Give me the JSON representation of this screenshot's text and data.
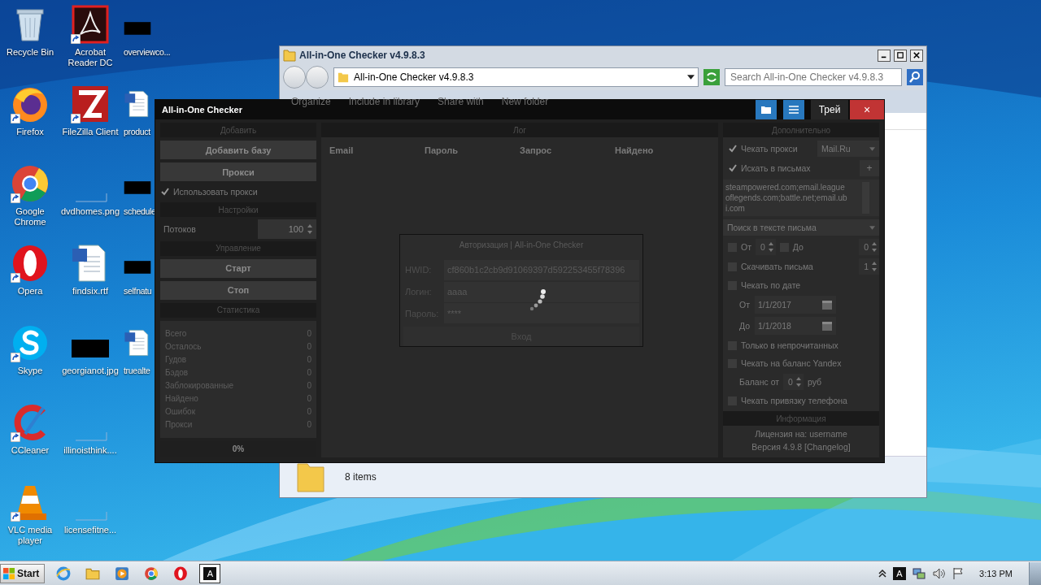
{
  "desktop": {
    "columns": [
      [
        {
          "label": "Recycle Bin",
          "kind": "recycle",
          "shortcut": false
        },
        {
          "label": "Firefox",
          "kind": "firefox",
          "shortcut": true
        },
        {
          "label": "Google Chrome",
          "kind": "chrome",
          "shortcut": true
        },
        {
          "label": "Opera",
          "kind": "opera",
          "shortcut": true
        },
        {
          "label": "Skype",
          "kind": "skype",
          "shortcut": true
        },
        {
          "label": "CCleaner",
          "kind": "ccleaner",
          "shortcut": true
        },
        {
          "label": "VLC media player",
          "kind": "vlc",
          "shortcut": true
        }
      ],
      [
        {
          "label": "Acrobat Reader DC",
          "kind": "acrobat",
          "shortcut": true
        },
        {
          "label": "FileZilla Client",
          "kind": "filezilla",
          "shortcut": true
        },
        {
          "label": "dvdhomes.png",
          "kind": "blank",
          "shortcut": false
        },
        {
          "label": "findsix.rtf",
          "kind": "word",
          "shortcut": false
        },
        {
          "label": "georgianot.jpg",
          "kind": "redacted",
          "shortcut": false
        },
        {
          "label": "illinoisthink....",
          "kind": "blank",
          "shortcut": false
        },
        {
          "label": "licensefitne...",
          "kind": "blank",
          "shortcut": false
        }
      ],
      [
        {
          "label": "overviewco...",
          "kind": "redacted",
          "shortcut": false
        },
        {
          "label": "product",
          "kind": "word",
          "shortcut": false
        },
        {
          "label": "schedule",
          "kind": "redacted",
          "shortcut": false
        },
        {
          "label": "selfnatu",
          "kind": "redacted",
          "shortcut": false
        },
        {
          "label": "truealte",
          "kind": "word",
          "shortcut": false
        }
      ]
    ]
  },
  "explorer": {
    "title": "All-in-One Checker v4.9.8.3",
    "address": "All-in-One Checker v4.9.8.3",
    "search_placeholder": "Search All-in-One Checker v4.9.8.3",
    "toolbar": [
      "Organize",
      "Include in library",
      "Share with",
      "New folder"
    ],
    "status": "8 items"
  },
  "checker": {
    "title": "All-in-One Checker",
    "title_buttons": [
      {
        "kind": "folder"
      },
      {
        "kind": "menu"
      },
      {
        "kind": "text",
        "label": "Трей"
      },
      {
        "kind": "close",
        "label": "×"
      }
    ],
    "add": {
      "header": "Добавить",
      "buttons": [
        "Добавить базу",
        "Прокси"
      ],
      "use_proxy": {
        "label": "Использовать прокси",
        "checked": true
      }
    },
    "settings": {
      "header": "Настройки",
      "threads_label": "Потоков",
      "threads": "100"
    },
    "control": {
      "header": "Управление",
      "buttons": [
        "Старт",
        "Стоп"
      ]
    },
    "stats": {
      "header": "Статистика",
      "rows": [
        {
          "label": "Всего",
          "value": "0"
        },
        {
          "label": "Осталось",
          "value": "0"
        },
        {
          "label": "Гудов",
          "value": "0"
        },
        {
          "label": "Бэдов",
          "value": "0"
        },
        {
          "label": "Заблокированные",
          "value": "0"
        },
        {
          "label": "Найдено",
          "value": "0"
        },
        {
          "label": "Ошибок",
          "value": "0"
        },
        {
          "label": "Прокси",
          "value": "0"
        }
      ],
      "progress": "0%"
    },
    "log": {
      "header": "Лог",
      "columns": [
        "Email",
        "Пароль",
        "Запрос",
        "Найдено"
      ]
    },
    "auth_dialog": {
      "title": "Авторизация | All-in-One Checker",
      "fields": [
        {
          "label": "HWID:",
          "value": "cf860b1c2cb9d91069397d592253455f78396"
        },
        {
          "label": "Логин:",
          "value": "aaaa"
        },
        {
          "label": "Пароль:",
          "value": "****"
        }
      ],
      "button": "Вход"
    },
    "extra": {
      "header": "Дополнительно",
      "check_proxy": {
        "label": "Чекать прокси",
        "checked": true,
        "service": "Mail.Ru"
      },
      "search_in_mail": {
        "label": "Искать в письмах",
        "checked": true,
        "add": "+"
      },
      "domains": "steampowered.com;email.leagueoflegends.com;battle.net;email.ubi.com",
      "search_mode": "Поиск в тексте письма",
      "range_from": {
        "label": "От",
        "checked": false,
        "value": "0"
      },
      "range_to": {
        "label": "До",
        "checked": false,
        "value": "0"
      },
      "download": {
        "label": "Скачивать письма",
        "checked": false,
        "value": "1"
      },
      "by_date": {
        "label": "Чекать по дате",
        "checked": false,
        "from_label": "От",
        "from": "1/1/2017",
        "to_label": "До",
        "to": "1/1/2018"
      },
      "unread": {
        "label": "Только в непрочитанных",
        "checked": false
      },
      "yandex": {
        "label": "Чекать на баланс Yandex",
        "checked": false
      },
      "balance": {
        "label": "Баланс от",
        "value": "0",
        "unit": "руб"
      },
      "phone": {
        "label": "Чекать привязку телефона",
        "checked": false
      }
    },
    "info": {
      "header": "Информация",
      "license": "Лицензия на: username",
      "version": "Версия 4.9.8 [Changelog]"
    }
  },
  "taskbar": {
    "start": "Start",
    "apps": [
      {
        "kind": "ie",
        "active": false
      },
      {
        "kind": "explorer",
        "active": false
      },
      {
        "kind": "media",
        "active": false
      },
      {
        "kind": "chrome",
        "active": false
      },
      {
        "kind": "opera",
        "active": false
      },
      {
        "kind": "letter",
        "label": "A",
        "active": true
      }
    ],
    "tray": [
      {
        "kind": "chevron"
      },
      {
        "kind": "letter",
        "label": "A"
      },
      {
        "kind": "network"
      },
      {
        "kind": "volume"
      },
      {
        "kind": "flag"
      }
    ],
    "clock": "3:13 PM"
  }
}
